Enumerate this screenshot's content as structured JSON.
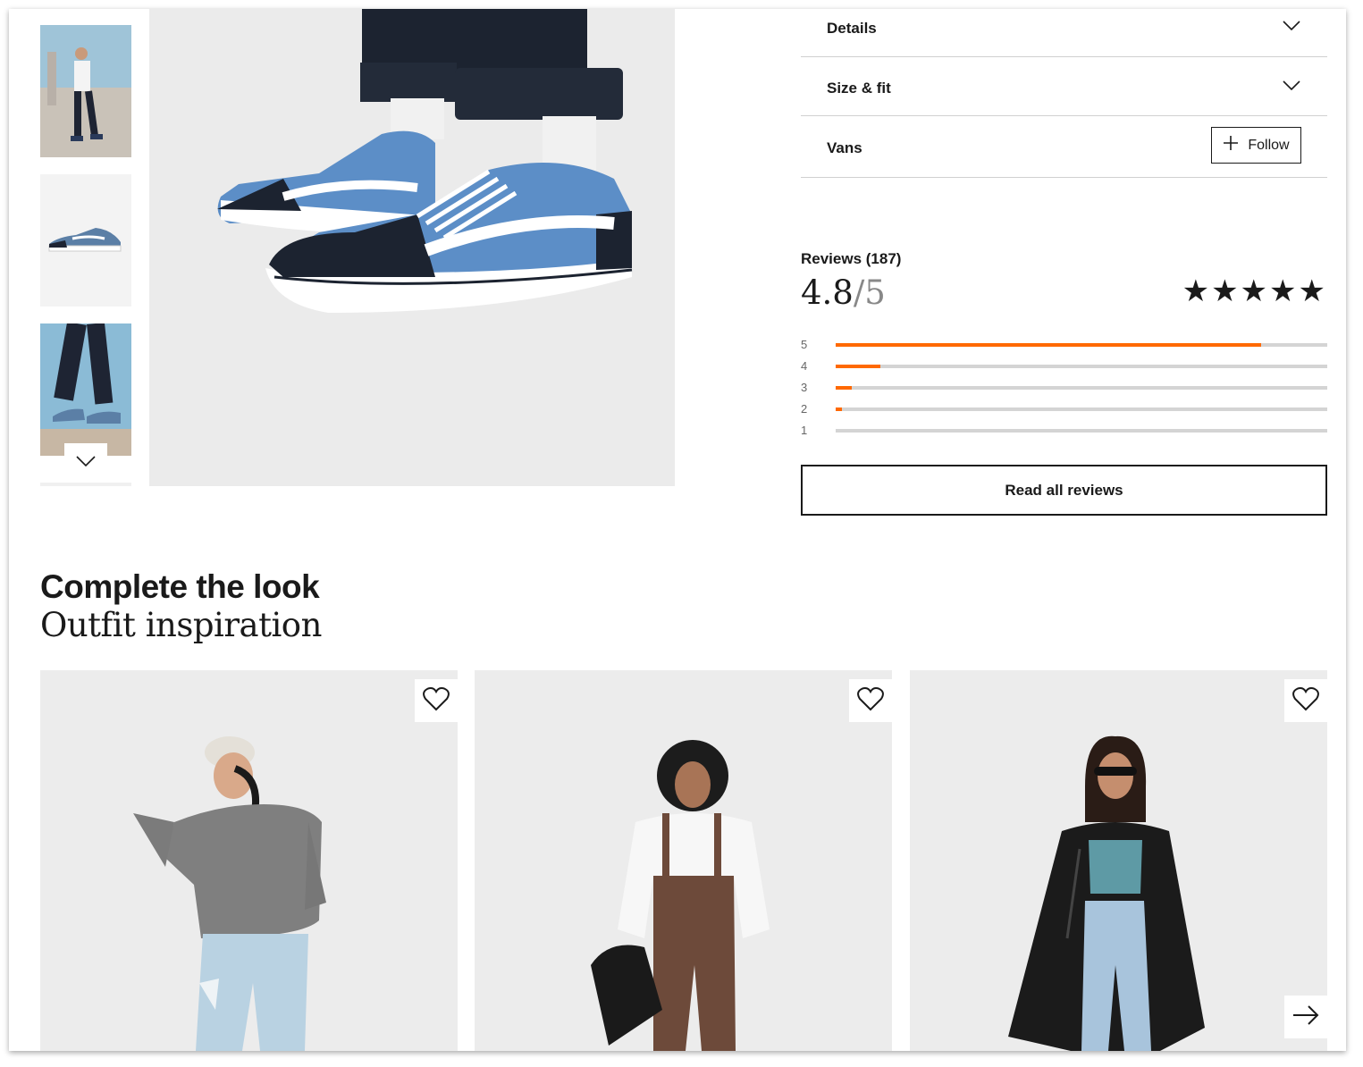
{
  "accordion": {
    "details_label": "Details",
    "size_fit_label": "Size & fit",
    "brand_label": "Vans",
    "follow_label": "Follow"
  },
  "reviews": {
    "title": "Reviews (187)",
    "rating": "4.8",
    "rating_max": "/5",
    "stars": "★★★★★",
    "distribution": [
      {
        "label": "5",
        "fraction": 0.865
      },
      {
        "label": "4",
        "fraction": 0.09
      },
      {
        "label": "3",
        "fraction": 0.032
      },
      {
        "label": "2",
        "fraction": 0.012
      },
      {
        "label": "1",
        "fraction": 0.0
      }
    ],
    "read_all_label": "Read all reviews"
  },
  "complete_look": {
    "title": "Complete the look",
    "subtitle": "Outfit inspiration"
  },
  "colors": {
    "accent_orange": "#ff6900",
    "text": "#1a1a1a",
    "divider": "#d0d0d0"
  },
  "icons": {
    "chevron": "chevron-down-icon",
    "plus": "plus-icon",
    "heart": "heart-icon",
    "arrow": "arrow-right-icon"
  }
}
